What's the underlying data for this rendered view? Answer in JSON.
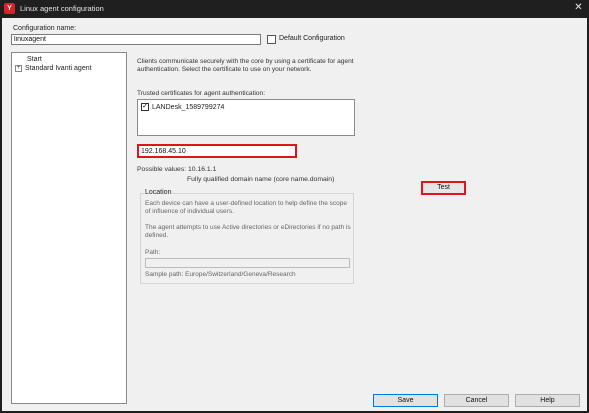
{
  "window": {
    "title": "Linux agent configuration",
    "app_icon_glyph": "Y",
    "close_glyph": "✕",
    "icon_names": {
      "app": "ivanti-app-icon",
      "close": "close-icon"
    }
  },
  "config": {
    "name_label": "Configuration name:",
    "name_value": "linuxagent",
    "default_label": "Default Configuration",
    "default_checked": false
  },
  "tree": {
    "items": [
      {
        "label": "Start"
      },
      {
        "label": "Standard Ivanti agent",
        "expand_glyph": "+"
      }
    ]
  },
  "main": {
    "description": "Clients communicate securely with the core by using a certificate for agent authentication. Select the certificate to use on your network.",
    "trusted_label": "Trusted certificates for agent authentication:",
    "certificates": [
      {
        "label": "LANDesk_1589799274",
        "checked": true,
        "check_glyph": "✓"
      }
    ],
    "core_address": "192.168.45.10",
    "possible_values": "Possible values: 10.16.1.1",
    "fqdn_hint": "Fully qualified domain name (core name.domain)",
    "test_label": "Test"
  },
  "location": {
    "legend": "Location",
    "text1": "Each device can have a user-defined location to help define the scope of influence of individual users.",
    "text2": "The agent attempts to use Active directories or eDirectories if no path is defined.",
    "path_label": "Path:",
    "path_value": "",
    "sample": "Sample path: Europe/Switzerland/Geneva/Research"
  },
  "footer": {
    "save": "Save",
    "cancel": "Cancel",
    "help": "Help"
  },
  "colors": {
    "highlight_red": "#e0151c",
    "title_bar": "#1f1f1f",
    "dialog_bg": "#f0f0f0",
    "brand_red": "#d2262b"
  }
}
